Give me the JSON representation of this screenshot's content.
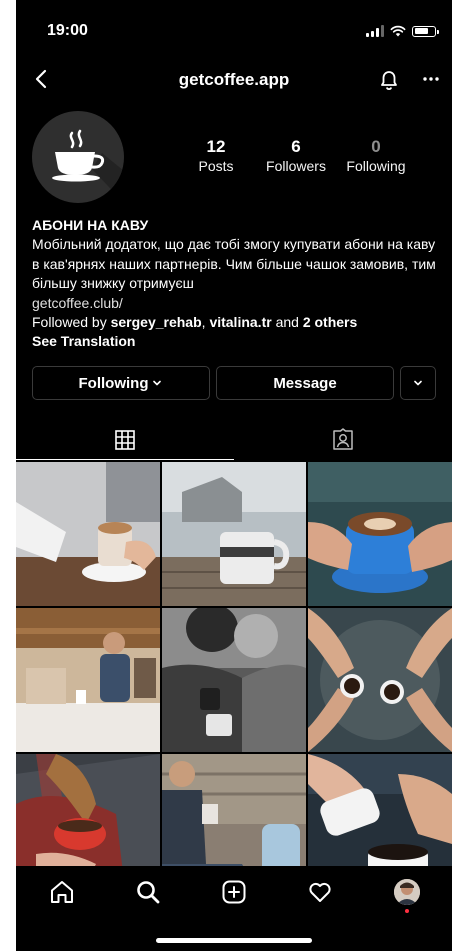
{
  "status_bar": {
    "time": "19:00"
  },
  "header": {
    "title": "getcoffee.app"
  },
  "profile": {
    "stats": [
      {
        "value": "12",
        "label": "Posts"
      },
      {
        "value": "6",
        "label": "Followers"
      },
      {
        "value": "0",
        "label": "Following"
      }
    ],
    "name": "АБОНИ НА КАВУ",
    "bio": "Мобільний додаток, що дає тобі змогу купувати абони на каву в кав'ярнях наших партнерів. Чим більше чашок замовив, тим більшу знижку отримуєш",
    "website": "getcoffee.club/",
    "followed_by": {
      "prefix": "Followed by ",
      "user1": "sergey_rehab",
      "sep": ", ",
      "user2": "vitalina.tr",
      "and": " and ",
      "others": "2 others"
    },
    "see_translation": "See Translation"
  },
  "actions": {
    "following_label": "Following",
    "message_label": "Message"
  },
  "icons": {
    "back": "chevron-left-icon",
    "bell": "bell-icon",
    "more": "more-horizontal-icon",
    "grid": "grid-icon",
    "tagged": "tagged-person-icon",
    "home": "home-icon",
    "search": "search-icon",
    "add": "add-post-icon",
    "activity": "heart-icon"
  },
  "colors": {
    "background": "#000000",
    "text": "#ffffff",
    "muted": "#8e8e8e",
    "border": "#3a3a3a",
    "notification_dot": "#ff3040"
  }
}
